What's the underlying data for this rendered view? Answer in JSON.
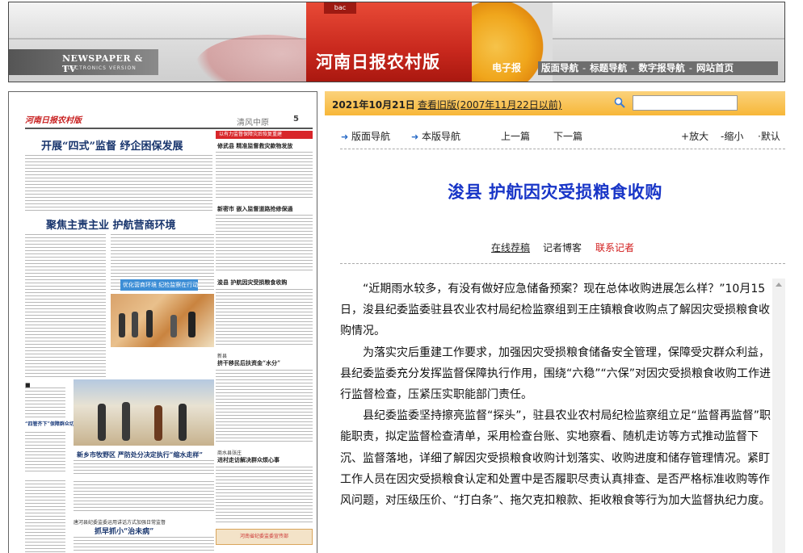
{
  "banner": {
    "newspaper_tv": "NEWSPAPER & TV",
    "electronics_version": "ELECTRONICS VERSION",
    "red_tab": "bac",
    "title": "河南日报农村版",
    "epaper": "电子报",
    "nav": [
      "版面导航",
      "标题导航",
      "数字报导航",
      "网站首页"
    ],
    "nav_separator": "-"
  },
  "newspaper": {
    "logo": "河南日报农村版",
    "section": "清风中原",
    "page_number": "5",
    "headlines": [
      "开展“四式”监督  纾企困保发展",
      "聚焦主责主业  护航营商环境",
      "优化营商环境 纪检监察在行动",
      "以有力监督保障灾后恢复重建",
      "修武县 精准监督救灾款物发放",
      "新密市 嵌入监督道路抢修保通",
      "浚县 护航因灾受损粮食收购",
      "新县",
      "挤干移民后扶资金“水分”",
      "“四管齐下”保障群众切身利益",
      "新乡市牧野区  严防处分决定执行“缩水走样”",
      "商水县张庄",
      "进村走访解决群众烦心事",
      "唐河县纪委监委运用讲话方式加强日常监督",
      "抓早抓小“治未病”",
      "河南省纪委监委宣传部"
    ]
  },
  "toolbar": {
    "date": "2021年10月21日",
    "old_version_link": "查看旧版(2007年11月22日以前)",
    "search_placeholder": "",
    "search_value": ""
  },
  "nav": {
    "page_nav": "版面导航",
    "this_page_nav": "本版导航",
    "prev": "上一篇",
    "next": "下一篇",
    "zoom_in": "放大",
    "zoom_out": "缩小",
    "default": "默认",
    "zoom_in_sign": "+",
    "zoom_out_sign": "-",
    "default_sign": "·"
  },
  "article": {
    "title": "浚县 护航因灾受损粮食收购",
    "online_submission": "在线荐稿",
    "reporter_blog": "记者博客",
    "contact_reporter": "联系记者",
    "paragraphs": [
      "“近期雨水较多，有没有做好应急储备预案？现在总体收购进展怎么样？”10月15日，浚县纪委监委驻县农业农村局纪检监察组到王庄镇粮食收购点了解因灾受损粮食收购情况。",
      "为落实灾后重建工作要求，加强因灾受损粮食储备安全管理，保障受灾群众利益，县纪委监委充分发挥监督保障执行作用，围绕“六稳”“六保”对因灾受损粮食收购工作进行监督检查，压紧压实职能部门责任。",
      "县纪委监委坚持擦亮监督“探头”，驻县农业农村局纪检监察组立足“监督再监督”职能职责，拟定监督检查清单，采用检查台账、实地察看、随机走访等方式推动监督下沉、监督落地，详细了解因灾受损粮食收购计划落实、收购进度和储存管理情况。紧盯工作人员在因灾受损粮食认定和处置中是否履职尽责认真排查、是否严格标准收购等作风问题，对压级压价、“打白条”、拖欠克扣粮款、拒收粮食等行为加大监督执纪力度。"
    ]
  },
  "colors": {
    "title_blue": "#1835c7",
    "contact_red": "#d11a1a",
    "datebar_orange": "#f7b738",
    "banner_red": "#c8281d",
    "nav_arrow_blue": "#2a6cc7"
  },
  "icons": {
    "search": "magnifier-icon",
    "nav_arrow": "arrow-right-icon",
    "scroll_up": "triangle-up-icon"
  }
}
